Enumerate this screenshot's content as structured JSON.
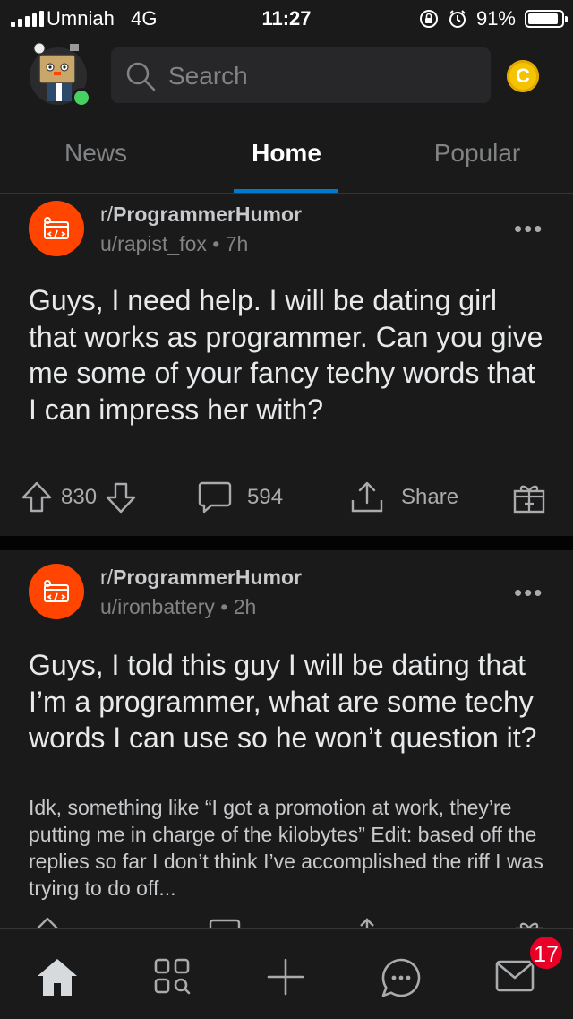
{
  "status_bar": {
    "carrier": "Umniah",
    "network": "4G",
    "time": "11:27",
    "battery_percent": "91%",
    "battery_level": 0.91,
    "icons": [
      "signal-icon",
      "orientation-lock-icon",
      "alarm-icon",
      "battery-icon"
    ]
  },
  "header": {
    "search_placeholder": "Search",
    "coin_symbol": "C"
  },
  "tabs": [
    {
      "label": "News",
      "active": false
    },
    {
      "label": "Home",
      "active": true
    },
    {
      "label": "Popular",
      "active": false
    }
  ],
  "posts": [
    {
      "subreddit_prefix": "r/",
      "subreddit": "ProgrammerHumor",
      "author": "u/rapist_fox",
      "age": "7h",
      "title": "Guys, I need help. I will be dating girl that works as programmer. Can you give me some of your fancy techy words that I can impress her with?",
      "body": "",
      "votes": "830",
      "comments": "594",
      "share_label": "Share"
    },
    {
      "subreddit_prefix": "r/",
      "subreddit": "ProgrammerHumor",
      "author": "u/ironbattery",
      "age": "2h",
      "title": "Guys, I told this guy I will be dating that I’m a programmer, what are some techy words I can use so he won’t question it?",
      "body": "Idk, something like “I got a promotion at work, they’re putting me in charge of the kilobytes” Edit: based off the replies so far I don’t think I’ve accomplished the riff I was trying to do off...",
      "votes": "",
      "comments": "",
      "share_label": ""
    }
  ],
  "bottom_nav": {
    "items": [
      "home-icon",
      "discover-icon",
      "create-post-icon",
      "chat-icon",
      "inbox-icon"
    ],
    "inbox_badge": "17"
  },
  "colors": {
    "background": "#1a1a1b",
    "accent": "#0079d3",
    "subreddit_icon": "#ff4500",
    "badge": "#ea0027",
    "online": "#46d160"
  }
}
